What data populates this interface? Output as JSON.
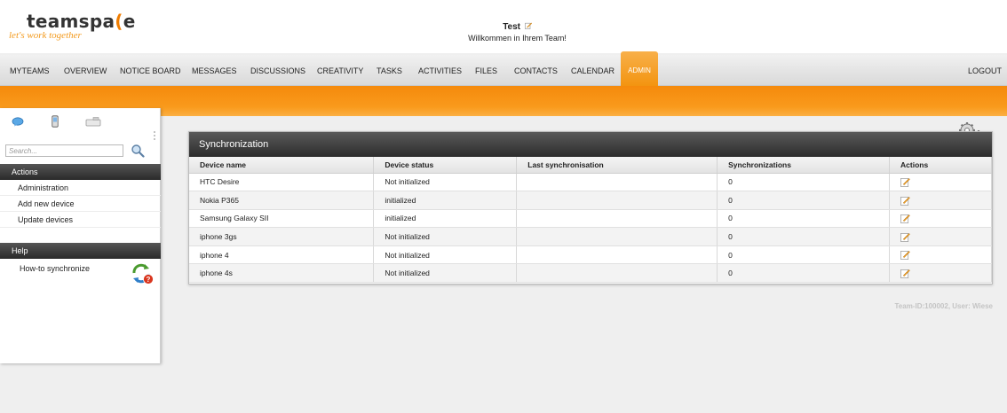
{
  "header": {
    "logo_name": "teamspa",
    "logo_tagline": "let's work together",
    "user": "Test",
    "welcome": "Willkommen in Ihrem Team!"
  },
  "nav": {
    "items": [
      "MYTEAMS",
      "OVERVIEW",
      "NOTICE BOARD",
      "MESSAGES",
      "DISCUSSIONS",
      "CREATIVITY",
      "TASKS",
      "ACTIVITIES",
      "FILES",
      "CONTACTS",
      "CALENDAR",
      "ADMIN"
    ],
    "active": "ADMIN",
    "logout": "LOGOUT"
  },
  "sidebar": {
    "search_placeholder": "Search...",
    "actions_title": "Actions",
    "actions": [
      "Administration",
      "Add new device",
      "Update devices"
    ],
    "help_title": "Help",
    "help_link": "How-to synchronize"
  },
  "panel": {
    "title": "Synchronization",
    "columns": [
      "Device name",
      "Device status",
      "Last synchronisation",
      "Synchronizations",
      "Actions"
    ],
    "rows": [
      {
        "name": "HTC Desire",
        "status": "Not initialized",
        "last": "",
        "count": "0"
      },
      {
        "name": "Nokia P365",
        "status": "initialized",
        "last": "",
        "count": "0"
      },
      {
        "name": "Samsung Galaxy SII",
        "status": "initialized",
        "last": "",
        "count": "0"
      },
      {
        "name": "iphone 3gs",
        "status": "Not initialized",
        "last": "",
        "count": "0"
      },
      {
        "name": "iphone 4",
        "status": "Not initialized",
        "last": "",
        "count": "0"
      },
      {
        "name": "iphone 4s",
        "status": "Not initialized",
        "last": "",
        "count": "0"
      }
    ]
  },
  "footer": {
    "team_id": "Team-ID:100002, User: Wiese"
  },
  "colors": {
    "accent_orange": "#f39410",
    "header_dark": "#333333"
  },
  "icons": [
    "edit-icon",
    "search-icon",
    "gears-icon",
    "sync-help-icon",
    "chat-icon",
    "phone-icon",
    "device-icon"
  ]
}
